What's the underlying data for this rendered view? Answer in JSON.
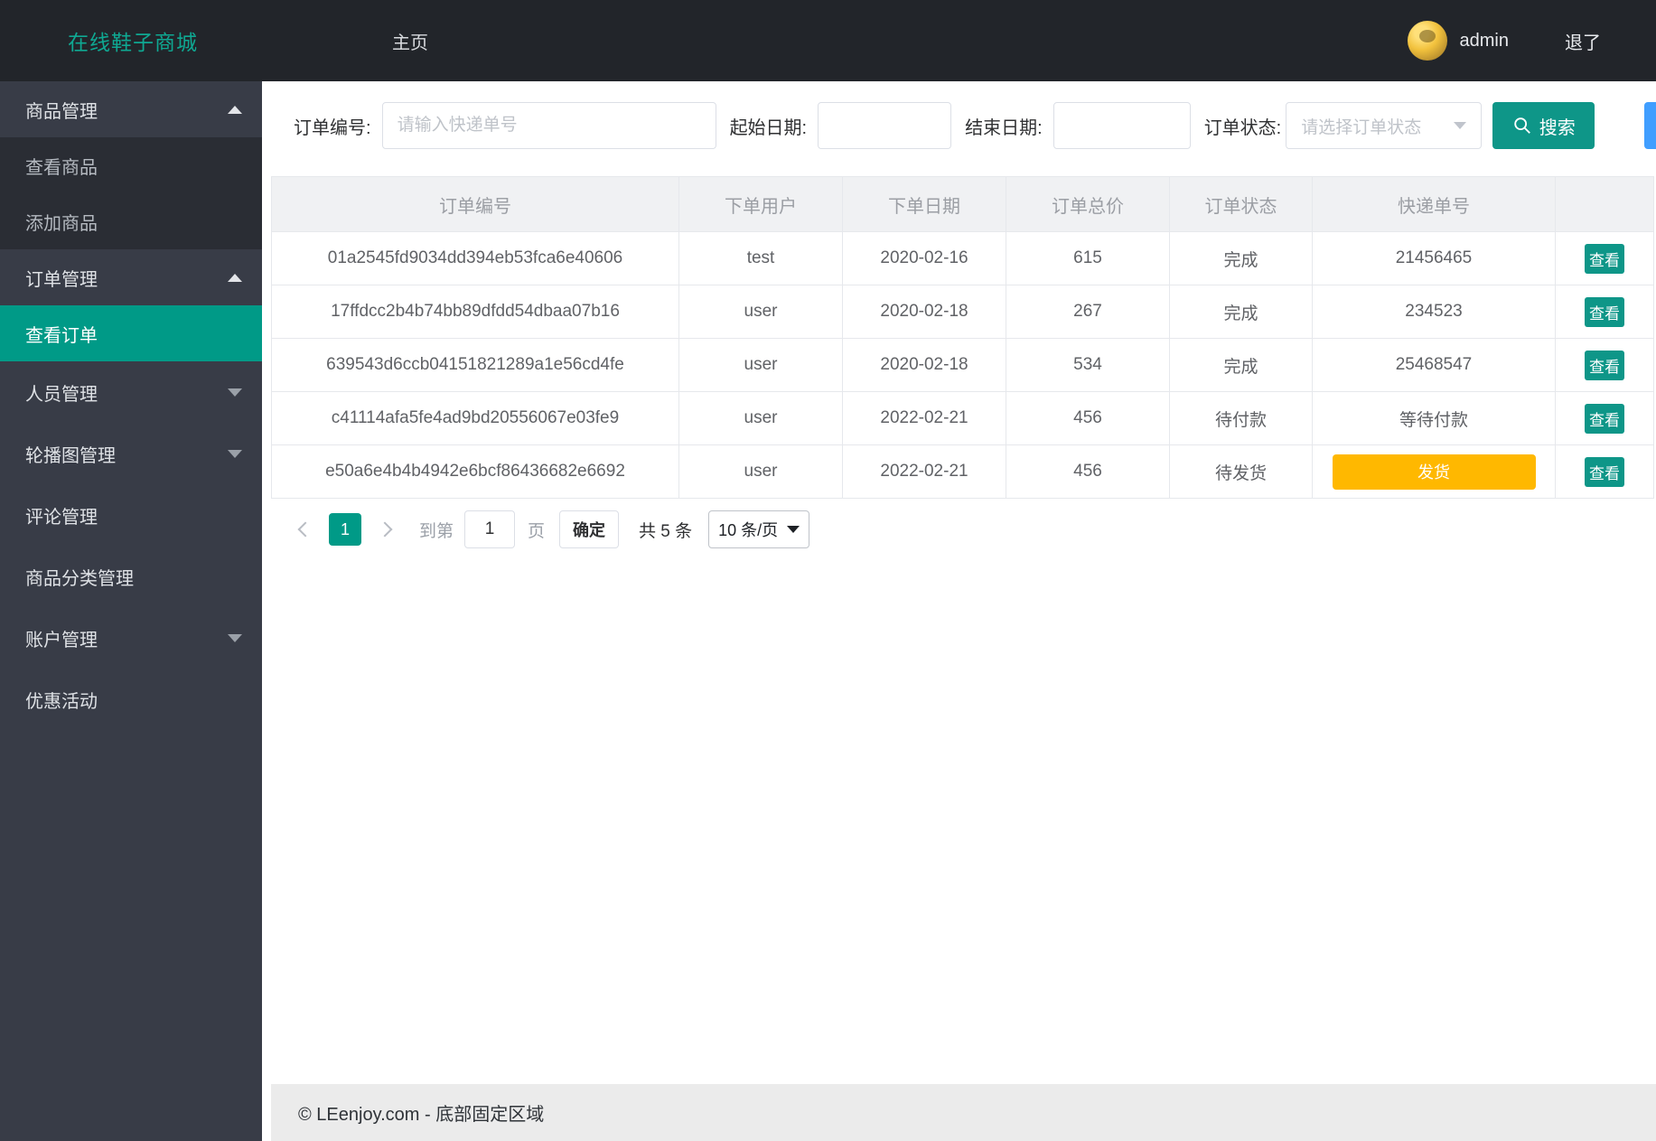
{
  "header": {
    "logo": "在线鞋子商城",
    "nav_home": "主页",
    "username": "admin",
    "logout": "退了"
  },
  "sidebar": {
    "items": [
      {
        "label": "商品管理",
        "type": "parent",
        "arrow": "up",
        "active": false
      },
      {
        "label": "查看商品",
        "type": "sub",
        "arrow": "",
        "active": false
      },
      {
        "label": "添加商品",
        "type": "sub",
        "arrow": "",
        "active": false
      },
      {
        "label": "订单管理",
        "type": "parent",
        "arrow": "up",
        "active": false
      },
      {
        "label": "查看订单",
        "type": "sub",
        "arrow": "",
        "active": true
      },
      {
        "label": "人员管理",
        "type": "parent",
        "arrow": "down",
        "active": false
      },
      {
        "label": "轮播图管理",
        "type": "parent",
        "arrow": "down",
        "active": false
      },
      {
        "label": "评论管理",
        "type": "parent",
        "arrow": "",
        "active": false
      },
      {
        "label": "商品分类管理",
        "type": "parent",
        "arrow": "",
        "active": false
      },
      {
        "label": "账户管理",
        "type": "parent",
        "arrow": "down",
        "active": false
      },
      {
        "label": "优惠活动",
        "type": "parent",
        "arrow": "",
        "active": false
      }
    ]
  },
  "filters": {
    "order_no_label": "订单编号:",
    "order_no_placeholder": "请输入快递单号",
    "order_no_value": "",
    "start_date_label": "起始日期:",
    "start_date_value": "",
    "end_date_label": "结束日期:",
    "end_date_value": "",
    "status_label": "订单状态:",
    "status_placeholder": "请选择订单状态",
    "search_label": "搜索"
  },
  "table": {
    "columns": [
      "订单编号",
      "下单用户",
      "下单日期",
      "订单总价",
      "订单状态",
      "快递单号",
      ""
    ],
    "rows": [
      {
        "order_no": "01a2545fd9034dd394eb53fca6e40606",
        "user": "test",
        "date": "2020-02-16",
        "total": "615",
        "status": "完成",
        "tracking": "21456465",
        "tracking_is_button": false,
        "action": "查看"
      },
      {
        "order_no": "17ffdcc2b4b74bb89dfdd54dbaa07b16",
        "user": "user",
        "date": "2020-02-18",
        "total": "267",
        "status": "完成",
        "tracking": "234523",
        "tracking_is_button": false,
        "action": "查看"
      },
      {
        "order_no": "639543d6ccb04151821289a1e56cd4fe",
        "user": "user",
        "date": "2020-02-18",
        "total": "534",
        "status": "完成",
        "tracking": "25468547",
        "tracking_is_button": false,
        "action": "查看"
      },
      {
        "order_no": "c41114afa5fe4ad9bd20556067e03fe9",
        "user": "user",
        "date": "2022-02-21",
        "total": "456",
        "status": "待付款",
        "tracking": "等待付款",
        "tracking_is_button": false,
        "action": "查看"
      },
      {
        "order_no": "e50a6e4b4b4942e6bcf86436682e6692",
        "user": "user",
        "date": "2022-02-21",
        "total": "456",
        "status": "待发货",
        "tracking": "发货",
        "tracking_is_button": true,
        "action": "查看"
      }
    ]
  },
  "pagination": {
    "current_page": "1",
    "goto_label": "到第",
    "goto_value": "1",
    "page_unit": "页",
    "confirm_label": "确定",
    "total_label": "共 5 条",
    "page_size": "10 条/页"
  },
  "footer": {
    "copyright": "© LEenjoy.com - 底部固定区域"
  },
  "colors": {
    "accent": "#0e9688",
    "active": "#009a87",
    "warning": "#ffb800",
    "link_blue": "#409eff",
    "header_bg": "#22252a",
    "sidebar_bg": "#383c47",
    "sidebar_sub_bg": "#2a2d34",
    "footer_bg": "#ebebeb",
    "logo": "#0fa892"
  }
}
